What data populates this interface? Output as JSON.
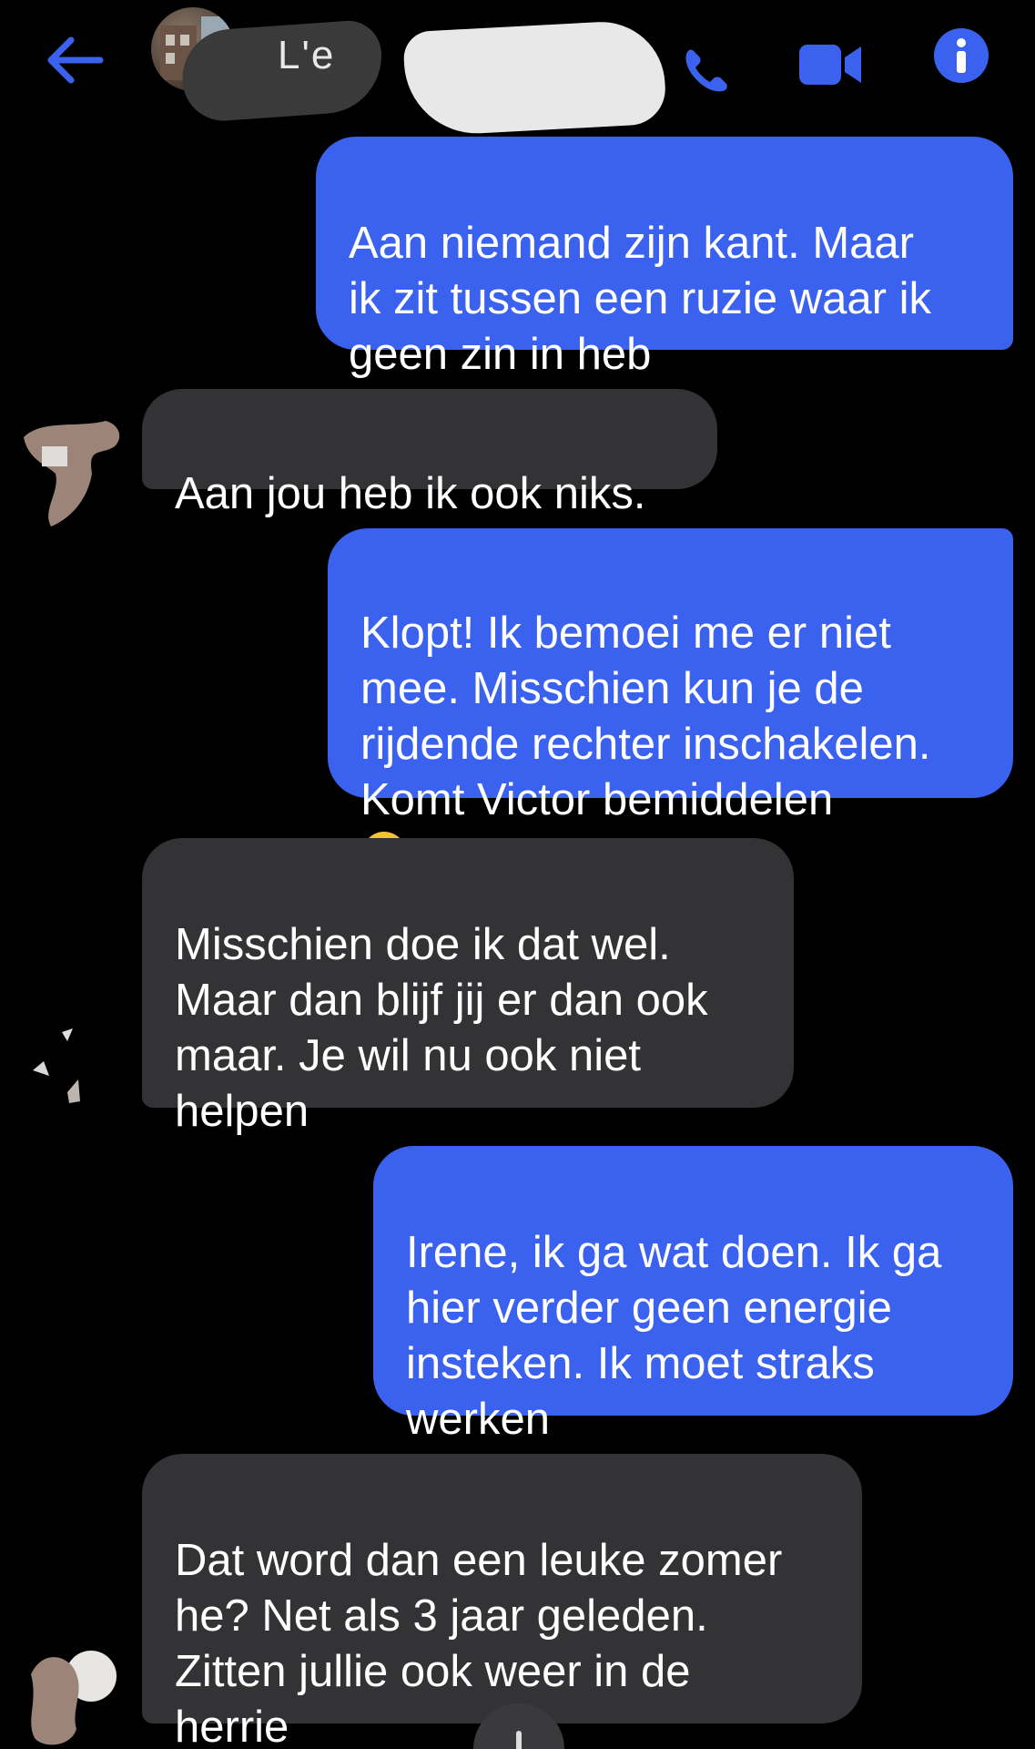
{
  "header": {
    "title_fragment": "L'e",
    "accent_color": "#3b62ef",
    "icons": [
      "back-arrow-icon",
      "phone-icon",
      "video-camera-icon",
      "info-icon"
    ]
  },
  "messages": [
    {
      "sender": "me",
      "text": "Aan niemand zijn kant. Maar\nik zit tussen een ruzie waar ik\ngeen zin in heb"
    },
    {
      "sender": "them",
      "text": "Aan jou heb ik ook niks."
    },
    {
      "sender": "me",
      "text": "Klopt! Ik bemoei me er niet\nmee. Misschien kun je de\nrijdende rechter inschakelen.\nKomt Victor bemiddelen",
      "emoji": "rolling-on-the-floor-laughing-emoji"
    },
    {
      "sender": "them",
      "text": "Misschien doe ik dat wel.\nMaar dan blijf jij er dan ook\nmaar.  Je wil nu ook niet\nhelpen"
    },
    {
      "sender": "me",
      "text": "Irene, ik ga wat doen. Ik ga\nhier verder geen energie\ninsteken. Ik moet straks\nwerken"
    },
    {
      "sender": "them",
      "text": "Dat word dan een leuke zomer\nhe? Net als 3 jaar geleden.\nZitten jullie ook weer in de\nherrie"
    }
  ],
  "colors": {
    "my_bubble": "#3b62ef",
    "their_bubble": "#333335",
    "background": "#000000"
  }
}
